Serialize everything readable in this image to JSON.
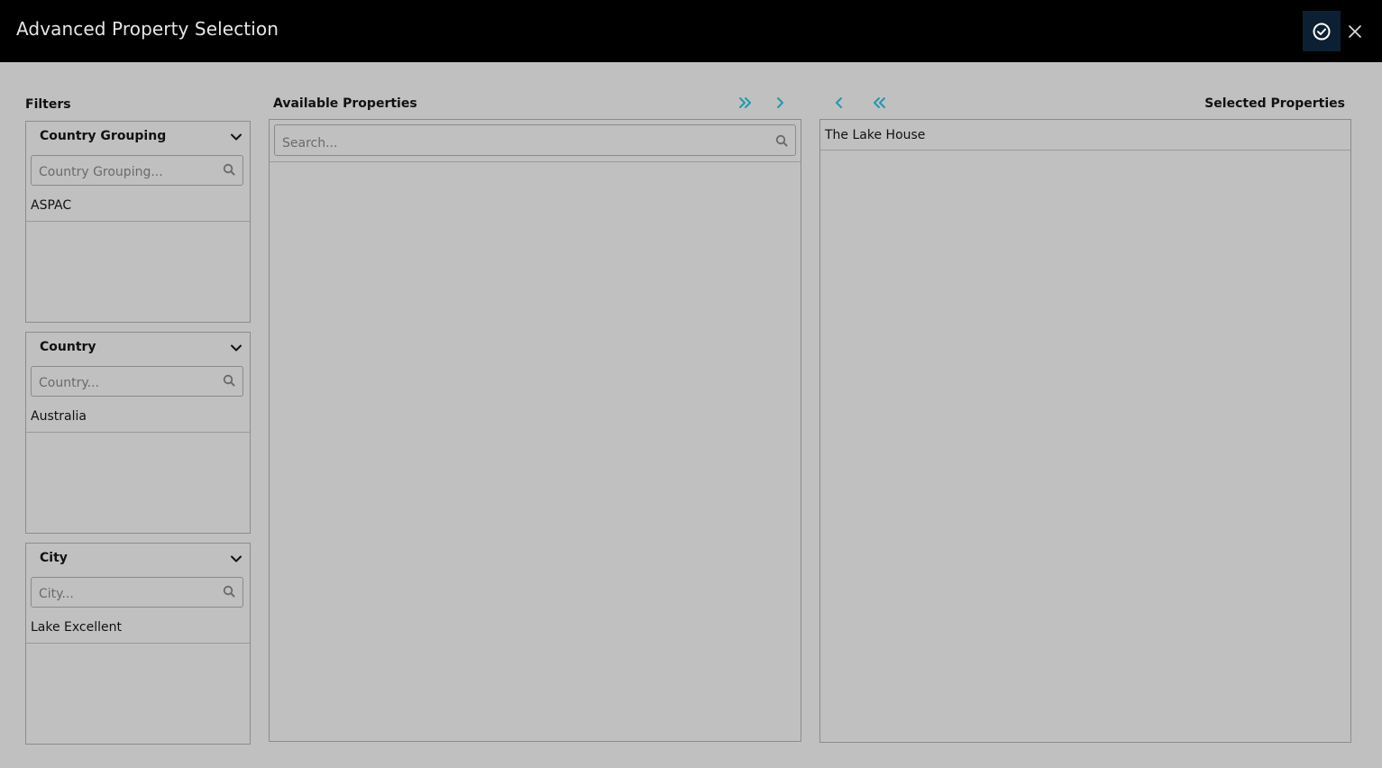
{
  "header": {
    "title": "Advanced Property Selection",
    "confirm_icon": "check-circle-icon",
    "close_icon": "close-icon"
  },
  "filters": {
    "title": "Filters",
    "groups": [
      {
        "label": "Country Grouping",
        "placeholder": "Country Grouping...",
        "items": [
          "ASPAC"
        ]
      },
      {
        "label": "Country",
        "placeholder": "Country...",
        "items": [
          "Australia"
        ]
      },
      {
        "label": "City",
        "placeholder": "City...",
        "items": [
          "Lake Excellent"
        ]
      }
    ]
  },
  "available": {
    "title": "Available Properties",
    "search_placeholder": "Search...",
    "items": []
  },
  "selected": {
    "title": "Selected Properties",
    "items": [
      "The Lake House"
    ]
  },
  "colors": {
    "accent": "#1a9bb0",
    "header_bg": "#000000",
    "confirm_bg": "#0d2033",
    "page_bg": "#c0c0c0"
  }
}
